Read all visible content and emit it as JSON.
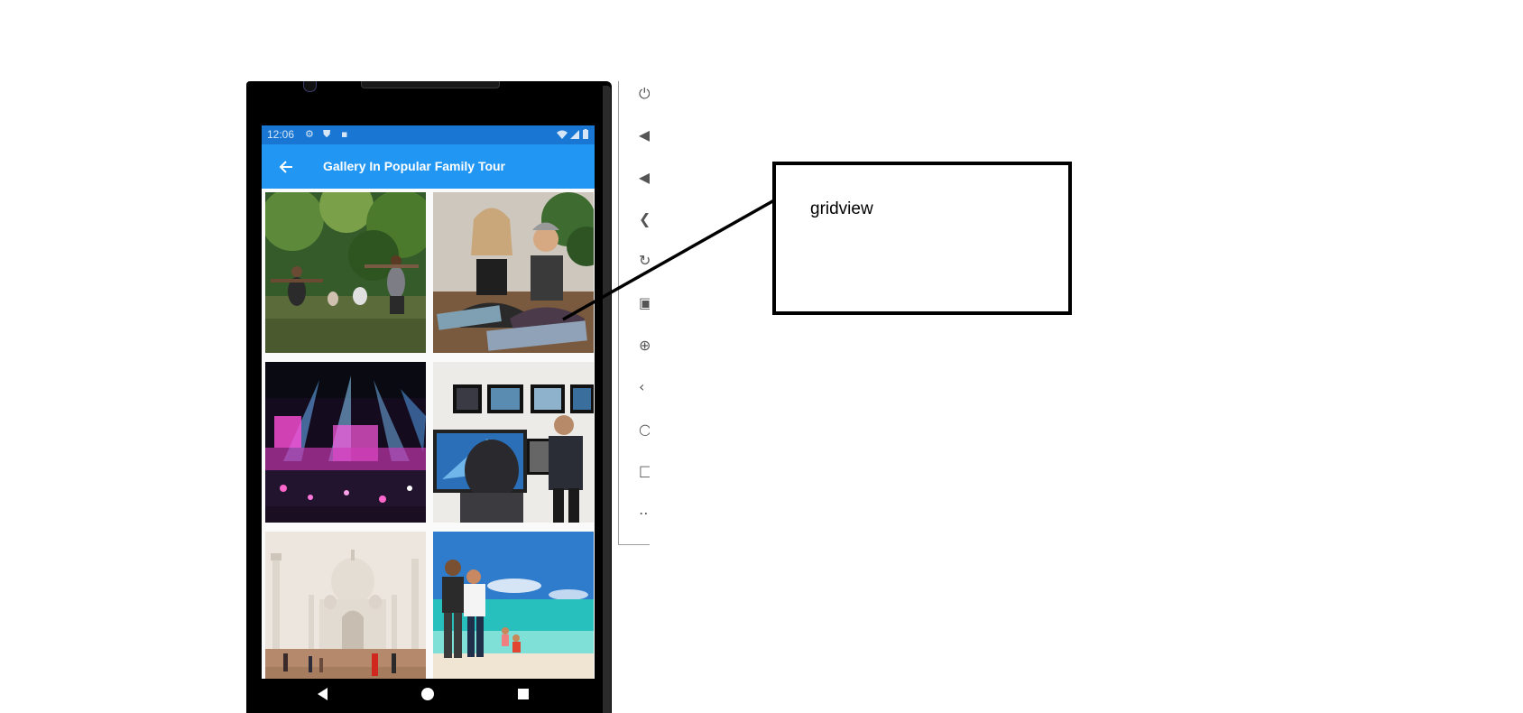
{
  "status_bar": {
    "time": "12:06",
    "left_icons": [
      "settings-icon",
      "shield-icon",
      "sd-card-icon"
    ],
    "right_icons": [
      "wifi-icon",
      "signal-icon",
      "battery-icon"
    ]
  },
  "app_bar": {
    "title": "Gallery In Popular Family Tour",
    "back_icon": "arrow-back-icon",
    "background": "#2196f3",
    "status_background": "#1976d2"
  },
  "gallery": {
    "columns": 2,
    "tiles": [
      {
        "name": "yoga-in-park-photo"
      },
      {
        "name": "meditation-couple-photo"
      },
      {
        "name": "concert-stage-photo"
      },
      {
        "name": "photo-gallery-exhibition-photo"
      },
      {
        "name": "taj-mahal-photo"
      },
      {
        "name": "beach-family-photo"
      }
    ]
  },
  "nav_bar": {
    "buttons": [
      "back-triangle-icon",
      "home-circle-icon",
      "recents-square-icon"
    ]
  },
  "emulator_toolbar": {
    "icons": [
      "power-icon",
      "volume-up-icon",
      "volume-down-icon",
      "rotate-left-icon",
      "rotate-right-icon",
      "camera-icon",
      "zoom-icon",
      "back-icon",
      "home-icon",
      "overview-icon",
      "more-icon"
    ]
  },
  "annotation": {
    "label": "gridview"
  }
}
